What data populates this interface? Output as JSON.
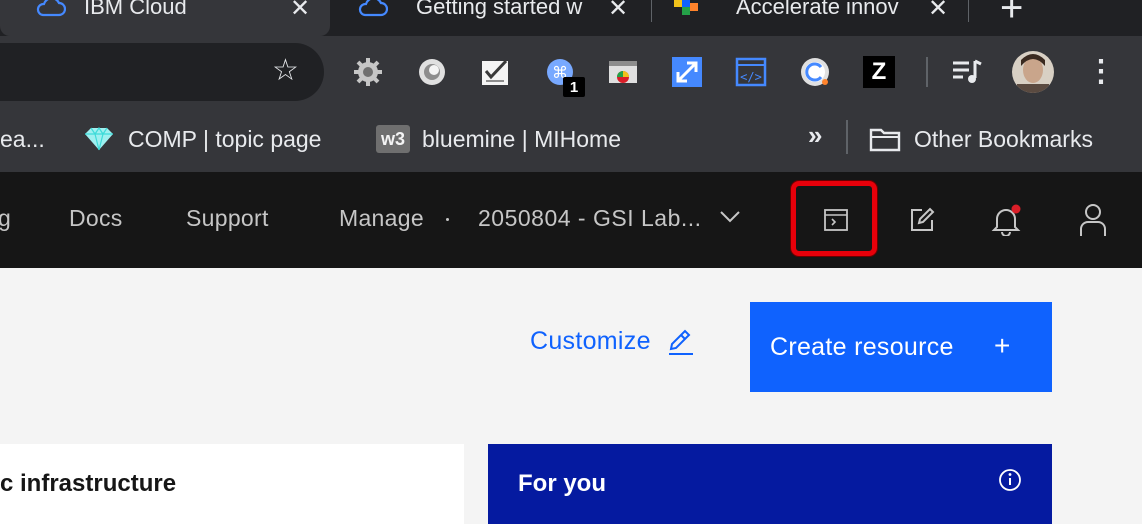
{
  "browser": {
    "tabs": [
      {
        "title": "IBM Cloud",
        "active": true
      },
      {
        "title": "Getting started w",
        "active": false
      },
      {
        "title": "Accelerate innov",
        "active": false
      }
    ],
    "new_tab_symbol": "+",
    "close_symbol": "✕",
    "extension_badge": "1",
    "zotero_letter": "Z",
    "star_symbol": "☆",
    "menu_symbol": "⋮"
  },
  "bookmarks": {
    "items": [
      {
        "label": "ea..."
      },
      {
        "label": "COMP | topic page"
      },
      {
        "label": "bluemine | MIHome",
        "icon_text": "w3"
      }
    ],
    "overflow": "»",
    "other": "Other Bookmarks"
  },
  "ibm_header": {
    "nav": [
      "g",
      "Docs",
      "Support",
      "Manage"
    ],
    "account": "2050804 - GSI Lab...",
    "colors": {
      "header_bg": "#161616",
      "highlight": "#e8000a",
      "notification_dot": "#da1e28"
    }
  },
  "main": {
    "customize_label": "Customize",
    "create_resource_label": "Create resource",
    "create_resource_plus": "+",
    "infra_card_title": "c infrastructure",
    "for_you_title": "For you",
    "info_symbol": "ⓘ",
    "colors": {
      "primary": "#0f62fe",
      "for_you_bg": "#051aa0"
    }
  }
}
